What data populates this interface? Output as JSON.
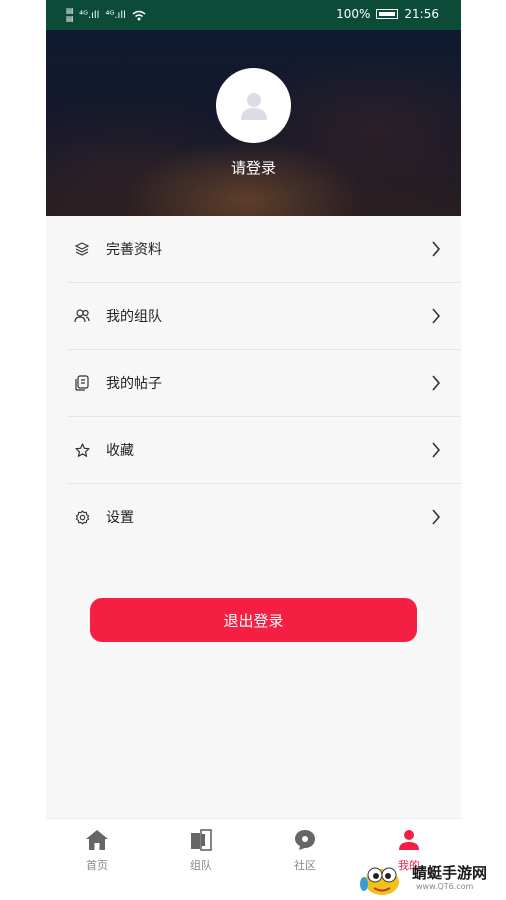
{
  "status_bar": {
    "battery": "100%",
    "time": "21:56"
  },
  "header": {
    "login_prompt": "请登录"
  },
  "menu": {
    "items": [
      {
        "icon": "layers-icon",
        "label": "完善资料"
      },
      {
        "icon": "users-icon",
        "label": "我的组队"
      },
      {
        "icon": "document-icon",
        "label": "我的帖子"
      },
      {
        "icon": "star-icon",
        "label": "收藏"
      },
      {
        "icon": "settings-icon",
        "label": "设置"
      }
    ]
  },
  "logout_label": "退出登录",
  "tabbar": {
    "tabs": [
      {
        "icon": "home-icon",
        "label": "首页"
      },
      {
        "icon": "team-icon",
        "label": "组队"
      },
      {
        "icon": "chat-icon",
        "label": "社区"
      },
      {
        "icon": "profile-icon",
        "label": "我的"
      }
    ],
    "active": "我的"
  },
  "watermark": {
    "name": "蜻蜓手游网",
    "url": "www.QT6.com"
  },
  "colors": {
    "accent": "#f41f42",
    "status_bar": "#0d4b39"
  }
}
